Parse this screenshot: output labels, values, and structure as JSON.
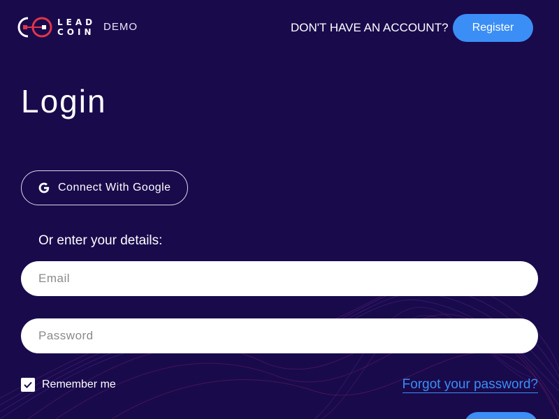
{
  "header": {
    "logo_line1": "LEAD",
    "logo_line2": "COIN",
    "demo_tag": "DEMO",
    "no_account_text": "DON'T HAVE AN ACCOUNT?",
    "register_label": "Register"
  },
  "main": {
    "title": "Login",
    "google_label": "Connect With Google",
    "or_text": "Or enter your details:",
    "email_placeholder": "Email",
    "password_placeholder": "Password",
    "remember_label": "Remember me",
    "remember_checked": true,
    "forgot_label": "Forgot your password?"
  },
  "colors": {
    "background": "#190a4c",
    "accent": "#3b8ef5",
    "logo_red": "#e0354a"
  }
}
